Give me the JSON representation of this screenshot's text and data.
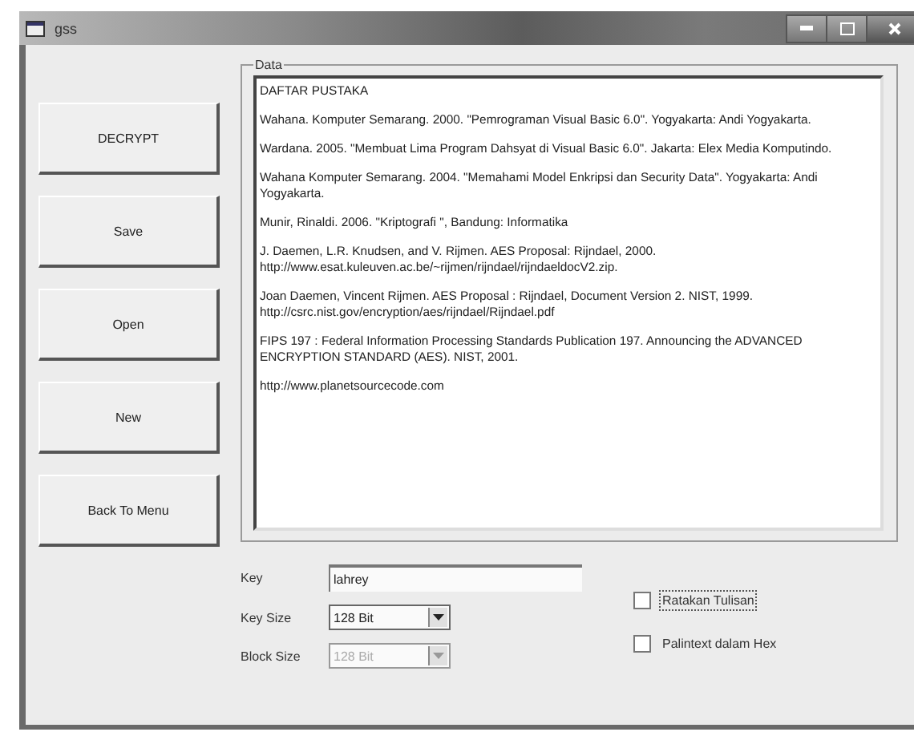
{
  "window": {
    "title": "gss"
  },
  "buttons": [
    {
      "label": "DECRYPT"
    },
    {
      "label": "Save"
    },
    {
      "label": "Open"
    },
    {
      "label": "New"
    },
    {
      "label": "Back To Menu"
    }
  ],
  "data_group": {
    "title": "Data",
    "paragraphs": [
      "DAFTAR PUSTAKA",
      "Wahana. Komputer Semarang. 2000. \"Pemrograman Visual Basic 6.0\". Yogyakarta: Andi Yogyakarta.",
      "Wardana. 2005. \"Membuat Lima Program Dahsyat di Visual Basic 6.0\". Jakarta: Elex Media Komputindo.",
      "Wahana Komputer Semarang. 2004. \"Memahami Model Enkripsi dan Security Data\". Yogyakarta: Andi Yogyakarta.",
      "Munir, Rinaldi. 2006. \"Kriptografi \", Bandung: Informatika",
      "J. Daemen, L.R. Knudsen, and V. Rijmen. AES Proposal: Rijndael, 2000.\nhttp://www.esat.kuleuven.ac.be/~rijmen/rijndael/rijndaeldocV2.zip.",
      "Joan Daemen, Vincent Rijmen. AES Proposal : Rijndael, Document Version 2. NIST, 1999.\nhttp://csrc.nist.gov/encryption/aes/rijndael/Rijndael.pdf",
      "FIPS 197 : Federal Information Processing Standards Publication 197. Announcing the ADVANCED ENCRYPTION STANDARD (AES). NIST, 2001.",
      "http://www.planetsourcecode.com"
    ]
  },
  "fields": [
    {
      "kind": "text",
      "label": "Key",
      "value": "lahrey"
    },
    {
      "kind": "combo",
      "label": "Key Size",
      "value": "128 Bit",
      "disabled": false
    },
    {
      "kind": "combo",
      "label": "Block Size",
      "value": "128 Bit",
      "disabled": true
    }
  ],
  "checkboxes": [
    {
      "label": "Ratakan Tulisan",
      "checked": false,
      "focused": true
    },
    {
      "label": "Palintext dalam Hex",
      "checked": false,
      "focused": false
    }
  ]
}
